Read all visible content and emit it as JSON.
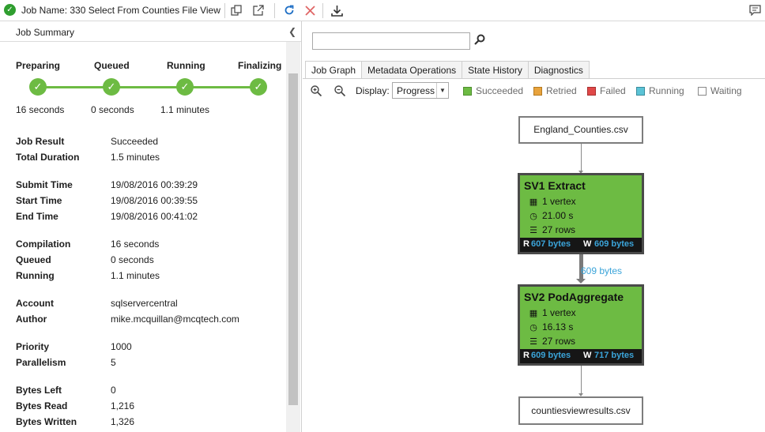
{
  "toolbar": {
    "job_name": "Job Name: 330 Select From Counties File View",
    "icons": [
      "status-ok-icon",
      "copy-script-icon",
      "open-external-icon",
      "refresh-icon",
      "cancel-job-icon",
      "download-icon",
      "feedback-icon"
    ]
  },
  "summary": {
    "title": "Job Summary",
    "stages": [
      {
        "label": "Preparing",
        "time": "16 seconds"
      },
      {
        "label": "Queued",
        "time": "0 seconds"
      },
      {
        "label": "Running",
        "time": "1.1 minutes"
      },
      {
        "label": "Finalizing",
        "time": ""
      }
    ],
    "fields": [
      {
        "key": "Job Result",
        "value": "Succeeded"
      },
      {
        "key": "Total Duration",
        "value": "1.5 minutes"
      },
      {
        "key": "Submit Time",
        "value": "19/08/2016 00:39:29"
      },
      {
        "key": "Start Time",
        "value": "19/08/2016 00:39:55"
      },
      {
        "key": "End Time",
        "value": "19/08/2016 00:41:02"
      },
      {
        "key": "Compilation",
        "value": "16 seconds"
      },
      {
        "key": "Queued",
        "value": "0 seconds"
      },
      {
        "key": "Running",
        "value": "1.1 minutes"
      },
      {
        "key": "Account",
        "value": "sqlservercentral"
      },
      {
        "key": "Author",
        "value": "mike.mcquillan@mcqtech.com"
      },
      {
        "key": "Priority",
        "value": "1000"
      },
      {
        "key": "Parallelism",
        "value": "5"
      },
      {
        "key": "Bytes Left",
        "value": "0"
      },
      {
        "key": "Bytes Read",
        "value": "1,216"
      },
      {
        "key": "Bytes Written",
        "value": "1,326"
      }
    ]
  },
  "search": {
    "value": "",
    "placeholder": ""
  },
  "tabs": [
    "Job Graph",
    "Metadata Operations",
    "State History",
    "Diagnostics"
  ],
  "display": {
    "label": "Display:",
    "value": "Progress"
  },
  "legend": [
    {
      "label": "Succeeded",
      "color": "#6dbb43"
    },
    {
      "label": "Retried",
      "color": "#e8a33c"
    },
    {
      "label": "Failed",
      "color": "#e04848"
    },
    {
      "label": "Running",
      "color": "#5bc3d6"
    },
    {
      "label": "Waiting",
      "color": "#ffffff"
    }
  ],
  "graph": {
    "input_file": "England_Counties.csv",
    "output_file": "countiesviewresults.csv",
    "edge_label": "609 bytes",
    "vertices": [
      {
        "title": "SV1 Extract",
        "vertices": "1 vertex",
        "time": "21.00 s",
        "rows": "27 rows",
        "r_label": "R",
        "read": "607 bytes",
        "w_label": "W",
        "written": "609 bytes"
      },
      {
        "title": "SV2 PodAggregate",
        "vertices": "1 vertex",
        "time": "16.13 s",
        "rows": "27 rows",
        "r_label": "R",
        "read": "609 bytes",
        "w_label": "W",
        "written": "717 bytes"
      }
    ]
  }
}
